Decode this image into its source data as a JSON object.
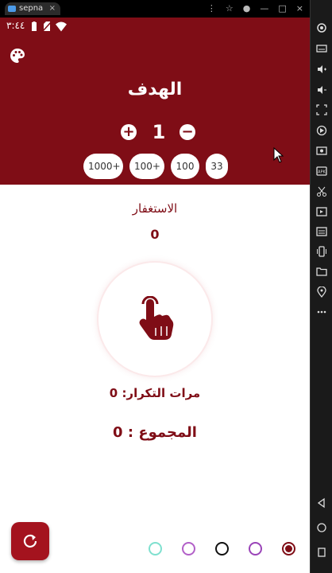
{
  "mirror": {
    "tab_label": "sepna",
    "tab_close": "×",
    "tools": [
      "⋮",
      "☆",
      "●",
      "—",
      "□",
      "×"
    ]
  },
  "status_bar": {
    "time": "٣:٤٤"
  },
  "header": {
    "title": "الهدف",
    "counter_value": "1",
    "plus_label": "+",
    "minus_label": "−",
    "chips": [
      "1000+",
      "100+",
      "100",
      "33"
    ]
  },
  "content": {
    "section_label": "الاستغفار",
    "section_count": "0",
    "repeat_label": "مرات التكرار:",
    "repeat_value": "0",
    "total_label": "المجموع :",
    "total_value": "0"
  },
  "theme": {
    "accent": "#7f0d16",
    "header_bg": "#7f0d16",
    "reset_bg": "#a4131e",
    "color_options": [
      {
        "name": "teal",
        "color": "#7fe0cf",
        "selected": false
      },
      {
        "name": "purple",
        "color": "#b260c8",
        "selected": false
      },
      {
        "name": "black",
        "color": "#111111",
        "selected": false
      },
      {
        "name": "violet",
        "color": "#9a44b8",
        "selected": false
      },
      {
        "name": "maroon",
        "color": "#7f0d16",
        "selected": true
      }
    ]
  },
  "icons": {
    "palette": "palette-icon",
    "tap": "hand-pointer-icon",
    "reset": "refresh-icon"
  }
}
